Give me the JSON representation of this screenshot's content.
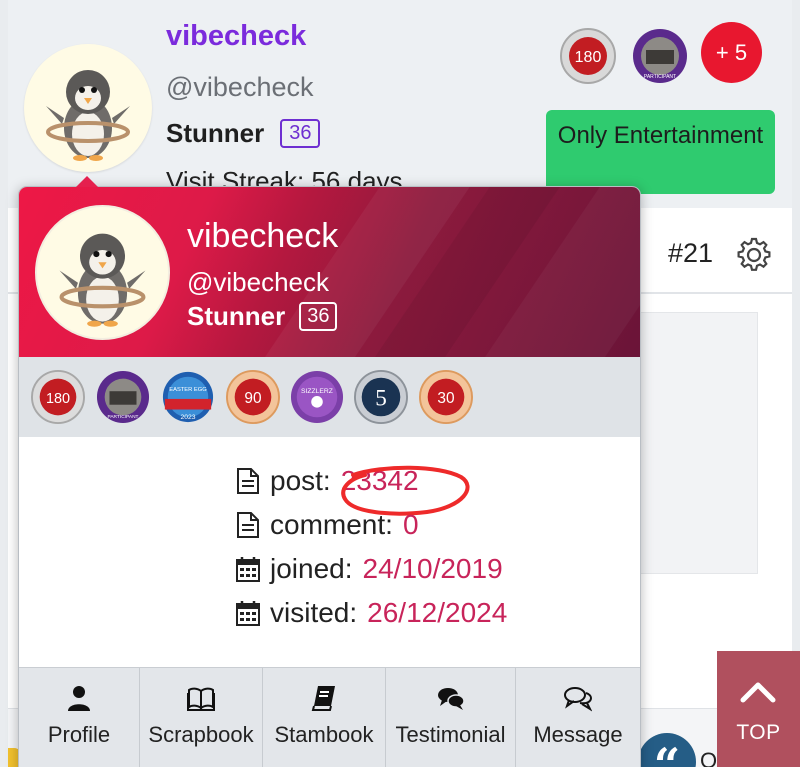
{
  "profile": {
    "username": "vibecheck",
    "handle": "@vibecheck",
    "rank": "Stunner",
    "level": "36",
    "streak": "Visit Streak: 56 days",
    "badges": [
      {
        "name": "180-badge-icon",
        "label": "180"
      },
      {
        "name": "participant-badge-icon",
        "label": "PARTICIPANT"
      }
    ],
    "more_badges": "+ 5",
    "category_button": "Only Entertainment",
    "post_number": "#21",
    "quote_label": "QUOTE"
  },
  "popup": {
    "username": "vibecheck",
    "handle": "@vibecheck",
    "rank": "Stunner",
    "level": "36",
    "badges": [
      {
        "name": "180-badge-icon",
        "label": "180"
      },
      {
        "name": "participant-badge-icon",
        "label": "PARTICIPANT"
      },
      {
        "name": "easter-egg-badge-icon",
        "label": "EASTER EGG",
        "year": "2023"
      },
      {
        "name": "90-badge-icon",
        "label": "90"
      },
      {
        "name": "sizzlerz-badge-icon",
        "label": "SIZZLERZ"
      },
      {
        "name": "5-anniversary-badge-icon",
        "label": "5"
      },
      {
        "name": "30-badge-icon",
        "label": "30"
      }
    ],
    "stats": [
      {
        "key": "post",
        "label": "post:",
        "value": "23342",
        "icon": "document-icon"
      },
      {
        "key": "comment",
        "label": "comment:",
        "value": "0",
        "icon": "document-icon"
      },
      {
        "key": "joined",
        "label": "joined:",
        "value": "24/10/2019",
        "icon": "calendar-icon"
      },
      {
        "key": "visited",
        "label": "visited:",
        "value": "26/12/2024",
        "icon": "calendar-icon"
      }
    ],
    "footer": [
      {
        "label": "Profile",
        "icon": "user-icon"
      },
      {
        "label": "Scrapbook",
        "icon": "open-book-icon"
      },
      {
        "label": "Stambook",
        "icon": "book-icon"
      },
      {
        "label": "Testimonial",
        "icon": "chat-bubbles-icon"
      },
      {
        "label": "Message",
        "icon": "message-bubbles-icon"
      }
    ]
  },
  "top_button": {
    "label": "TOP"
  },
  "colors": {
    "username_purple": "#7b2bdc",
    "header_red": "#e5204e",
    "stat_value": "#c8245a",
    "green_button": "#2fcb6f",
    "plus_red": "#e8172f",
    "top_button": "#b0505e",
    "annotation_red": "#ee2a2a"
  }
}
